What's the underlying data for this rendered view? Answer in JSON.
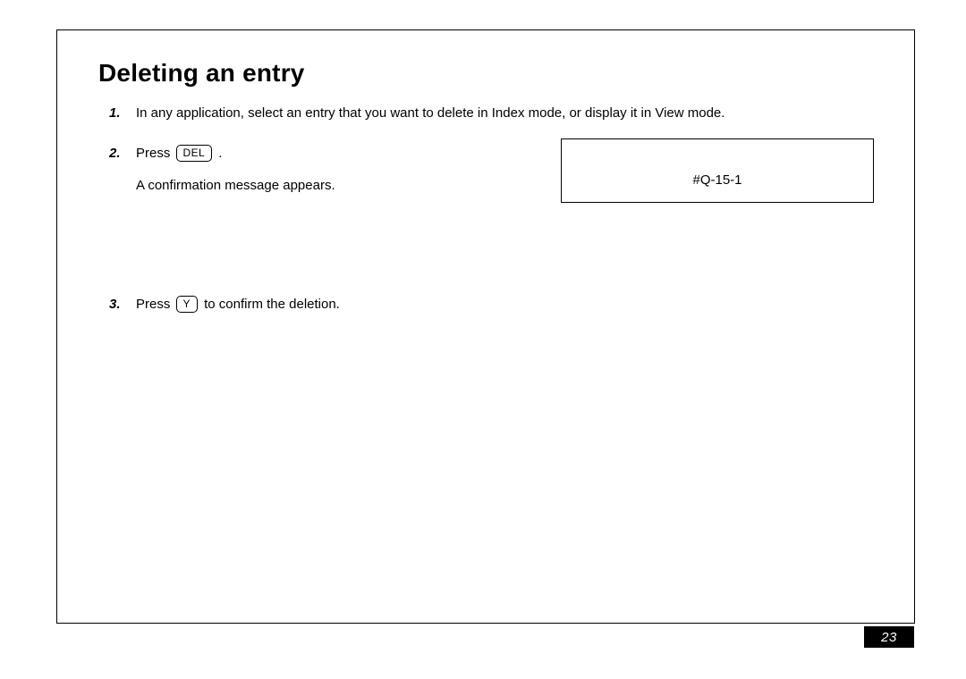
{
  "title": "Deleting an entry",
  "steps": {
    "s1": {
      "num": "1.",
      "text": "In any application, select an entry that you want to delete in Index mode, or display it in View mode."
    },
    "s2": {
      "num": "2.",
      "press": "Press ",
      "key": "DEL",
      "period": " .",
      "sub": "A confirmation message appears."
    },
    "s3": {
      "num": "3.",
      "press": "Press ",
      "key": "Y",
      "rest": " to confirm the deletion."
    }
  },
  "callout": "#Q-15-1",
  "page_number": "23"
}
